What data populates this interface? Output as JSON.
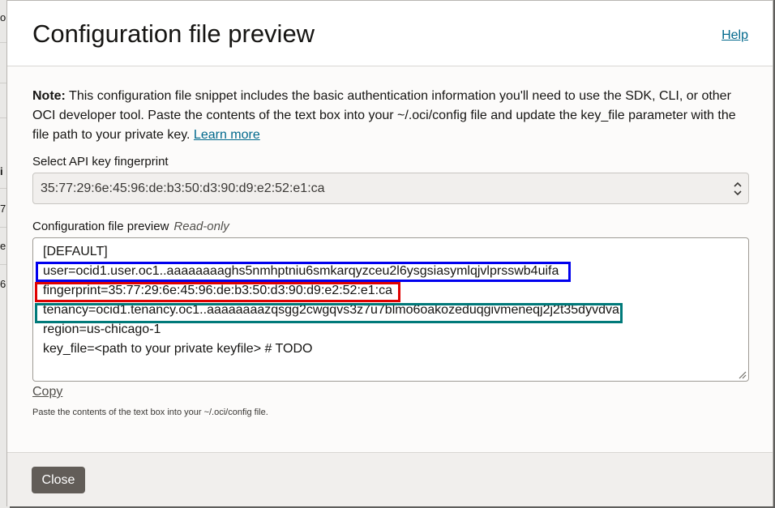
{
  "background": {
    "fragments": [
      "or",
      "i",
      "7",
      "e",
      "6"
    ]
  },
  "dialog": {
    "title": "Configuration file preview",
    "help_label": "Help"
  },
  "note": {
    "bold": "Note:",
    "text": " This configuration file snippet includes the basic authentication information you'll need to use the SDK, CLI, or other OCI developer tool. Paste the contents of the text box into your ~/.oci/config file and update the key_file parameter with the file path to your private key. ",
    "learn_more": "Learn more"
  },
  "fingerprint_select": {
    "label": "Select API key fingerprint",
    "value": "35:77:29:6e:45:96:de:b3:50:d3:90:d9:e2:52:e1:ca"
  },
  "config_preview": {
    "label": "Configuration file preview",
    "readonly_label": "Read-only",
    "lines": [
      "[DEFAULT]",
      "user=ocid1.user.oc1..aaaaaaaaghs5nmhptniu6smkarqyzceu2l6ysgsiasymlqjvlprsswb4uifa",
      "fingerprint=35:77:29:6e:45:96:de:b3:50:d3:90:d9:e2:52:e1:ca",
      "tenancy=ocid1.tenancy.oc1..aaaaaaaazqsgg2cwgqvs3z7u7blmo6oakozeduqgivmeneqj2j2t35dyvdva",
      "region=us-chicago-1",
      "key_file=<path to your private keyfile> # TODO"
    ],
    "highlight_colors": {
      "user": "#0000ee",
      "fingerprint": "#e00000",
      "tenancy": "#007a7a"
    }
  },
  "copy_label": "Copy",
  "helper_text": "Paste the contents of the text box into your ~/.oci/config file.",
  "footer": {
    "close_label": "Close"
  }
}
